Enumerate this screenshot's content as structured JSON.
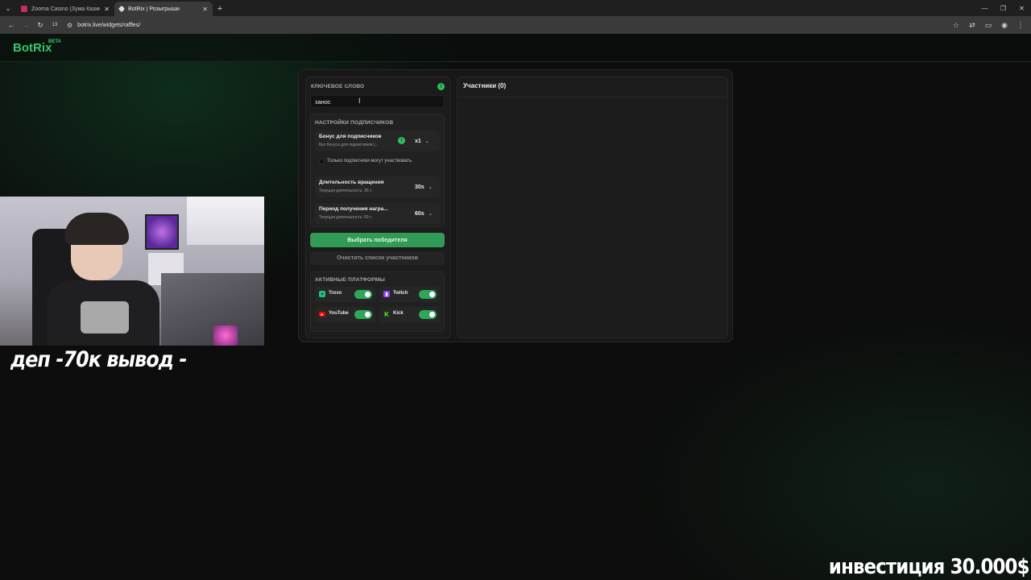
{
  "browser": {
    "tabs": [
      {
        "title": "Zooma Casino (Зума Казино) o",
        "favicon_color": "#c0305a",
        "active": false
      },
      {
        "title": "BotRix | Розыгрыши",
        "favicon_color": "#dddddd",
        "active": true
      }
    ],
    "url": "botrix.live/widgets/raffles/",
    "new_tab_symbol": "+",
    "icons": [
      "back-icon",
      "forward-icon",
      "reload-icon",
      "star-icon",
      "cast-icon",
      "extensions-icon",
      "profile-icon",
      "menu-icon"
    ]
  },
  "site": {
    "logo": "BotRix",
    "beta": "BETA"
  },
  "keyword": {
    "label": "Ключевое слово",
    "value": "занос"
  },
  "subscriber_settings": {
    "label": "Настройки подписчиков",
    "bonus": {
      "title": "Бонус для подписчиков",
      "subtitle": "Без бонуса для подписчиков (...",
      "value": "x1"
    },
    "only_subs": {
      "label": "Только подписчики могут участвовать",
      "checked": false
    },
    "spin_duration": {
      "title": "Длительность вращения",
      "subtitle": "Текущая длительность: 30 с",
      "value": "30s"
    },
    "reward_period": {
      "title": "Период получения награ...",
      "subtitle": "Текущая длительность: 60 с",
      "value": "60s"
    }
  },
  "buttons": {
    "pick_winner": "Выбрать победителя",
    "clear_list": "Очистить список участников"
  },
  "platforms": {
    "label": "Активные платформы",
    "items": [
      {
        "name": "Trovo",
        "enabled": true,
        "color": "#1fc17a"
      },
      {
        "name": "Twitch",
        "enabled": true,
        "color": "#9146ff"
      },
      {
        "name": "YouTube",
        "enabled": true,
        "color": "#ff0000"
      },
      {
        "name": "Kick",
        "enabled": true,
        "color": "#53fc18"
      }
    ]
  },
  "participants": {
    "title": "Участники (0)"
  },
  "overlay": {
    "caption": "деп -70к вывод -",
    "investment": "инвестиция 30.000$"
  },
  "colors": {
    "accent": "#2f9b55",
    "logo": "#36c76b"
  }
}
